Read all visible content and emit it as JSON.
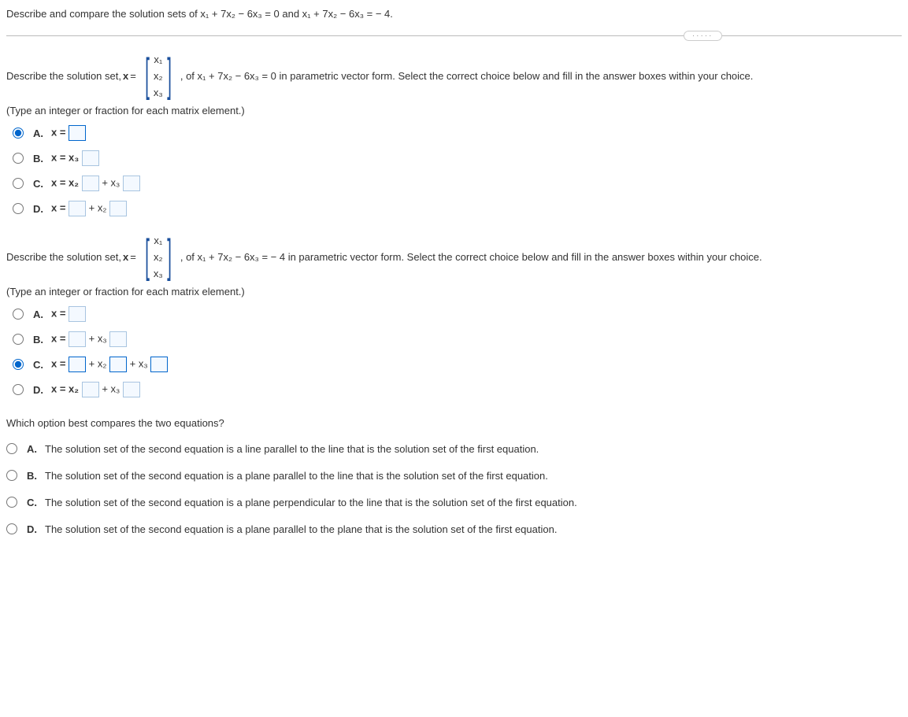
{
  "header": {
    "text": "Describe and compare the solution sets of x₁ + 7x₂ − 6x₃ = 0 and x₁ + 7x₂ − 6x₃ = − 4."
  },
  "section1": {
    "prompt_pre": "Describe the solution set, ",
    "x_eq": "x",
    "eq_sign": " = ",
    "vec": {
      "r1": "x₁",
      "r2": "x₂",
      "r3": "x₃"
    },
    "prompt_post": ", of x₁ + 7x₂ − 6x₃ = 0 in parametric vector form. Select the correct choice below and fill in the answer boxes within your choice.",
    "hint": "(Type an integer or fraction for each matrix element.)",
    "opts": {
      "A": {
        "label": "A.",
        "pre": "x = "
      },
      "B": {
        "label": "B.",
        "pre": "x = x₃"
      },
      "C": {
        "label": "C.",
        "pre": "x = x₂",
        "mid": " + x₃"
      },
      "D": {
        "label": "D.",
        "pre": "x = ",
        "mid": " + x₂"
      }
    }
  },
  "section2": {
    "prompt_pre": "Describe the solution set, ",
    "x_eq": "x",
    "eq_sign": " = ",
    "vec": {
      "r1": "x₁",
      "r2": "x₂",
      "r3": "x₃"
    },
    "prompt_post": ", of x₁ + 7x₂ − 6x₃ = − 4 in parametric vector form. Select the correct choice below and fill in the answer boxes within your choice.",
    "hint": "(Type an integer or fraction for each matrix element.)",
    "opts": {
      "A": {
        "label": "A.",
        "pre": "x = "
      },
      "B": {
        "label": "B.",
        "pre": "x = ",
        "mid": " + x₃"
      },
      "C": {
        "label": "C.",
        "pre": "x = ",
        "mid1": " + x₂",
        "mid2": " + x₃"
      },
      "D": {
        "label": "D.",
        "pre": "x = x₂",
        "mid": " + x₃"
      }
    }
  },
  "compare": {
    "question": "Which option best compares the two equations?",
    "opts": {
      "A": {
        "label": "A.",
        "text": "The solution set of the second equation is a line parallel to the line that is the solution set of the first equation."
      },
      "B": {
        "label": "B.",
        "text": "The solution set of the second equation is a plane parallel to the line that is the solution set of the first equation."
      },
      "C": {
        "label": "C.",
        "text": "The solution set of the second equation is a plane perpendicular to the line that is the solution set of the first equation."
      },
      "D": {
        "label": "D.",
        "text": "The solution set of the second equation is a plane parallel to the plane that is the solution set of the first equation."
      }
    }
  }
}
